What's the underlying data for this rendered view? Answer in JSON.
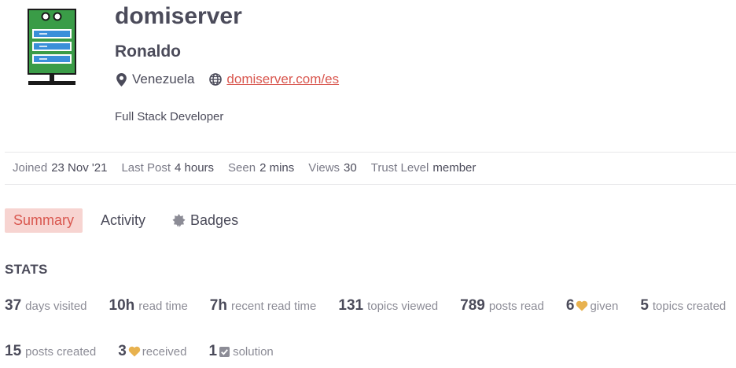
{
  "profile": {
    "username": "domiserver",
    "name": "Ronaldo",
    "location": "Venezuela",
    "website": "domiserver.com/es",
    "bio": "Full Stack Developer"
  },
  "details": [
    {
      "label": "Joined",
      "value": "23 Nov '21"
    },
    {
      "label": "Last Post",
      "value": "4 hours"
    },
    {
      "label": "Seen",
      "value": "2 mins"
    },
    {
      "label": "Views",
      "value": "30"
    },
    {
      "label": "Trust Level",
      "value": "member"
    }
  ],
  "nav": {
    "summary": "Summary",
    "activity": "Activity",
    "badges": "Badges"
  },
  "stats": {
    "heading": "STATS",
    "days_visited": {
      "value": "37",
      "label": "days visited"
    },
    "read_time": {
      "value": "10h",
      "label": "read time"
    },
    "recent_read_time": {
      "value": "7h",
      "label": "recent read time"
    },
    "topics_viewed": {
      "value": "131",
      "label": "topics viewed"
    },
    "posts_read": {
      "value": "789",
      "label": "posts read"
    },
    "likes_given": {
      "value": "6",
      "label": "given"
    },
    "topics_created": {
      "value": "5",
      "label": "topics created"
    },
    "posts_created": {
      "value": "15",
      "label": "posts created"
    },
    "likes_received": {
      "value": "3",
      "label": "received"
    },
    "solutions": {
      "value": "1",
      "label": "solution"
    }
  },
  "colors": {
    "accent": "#d9574f",
    "active_tab_bg": "#f7d4d1",
    "heart": "#e8b24f",
    "avatar_green": "#3a9c47",
    "avatar_blue": "#3a8fd9"
  },
  "icons": {
    "location": "map-marker-icon",
    "website": "globe-icon",
    "badges": "certificate-icon",
    "like": "heart-icon",
    "solution": "checkbox-icon"
  }
}
